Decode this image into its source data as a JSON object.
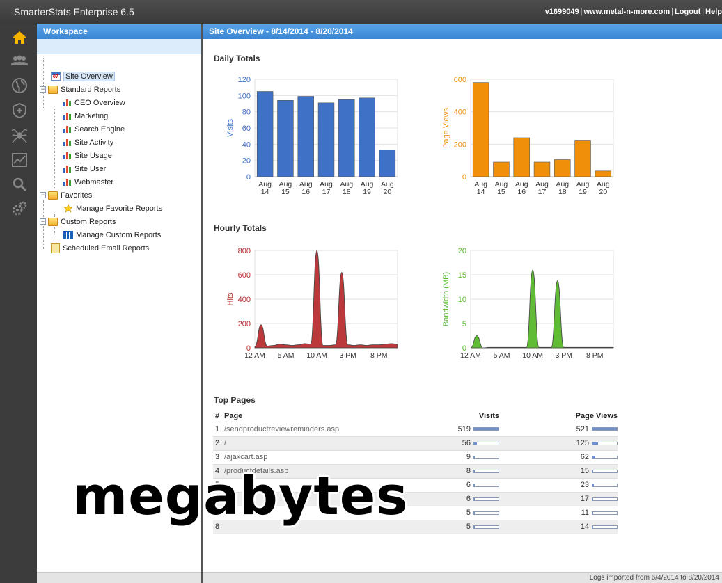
{
  "app": {
    "title": "SmarterStats Enterprise 6.5",
    "user_id": "v1699049",
    "site": "www.metal-n-more.com",
    "logout": "Logout",
    "help": "Help"
  },
  "iconbar": {
    "items": [
      "home-icon",
      "users-icon",
      "globe-icon",
      "shield-icon",
      "spider-icon",
      "chart-icon",
      "search-icon",
      "gears-icon"
    ]
  },
  "workspace": {
    "title": "Workspace",
    "tree": {
      "site_overview": "Site Overview",
      "site_overview_icon_text": "07",
      "standard_reports": "Standard Reports",
      "standard_items": [
        "CEO Overview",
        "Marketing",
        "Search Engine",
        "Site Activity",
        "Site Usage",
        "Site User",
        "Webmaster"
      ],
      "favorites": "Favorites",
      "manage_favorites": "Manage Favorite Reports",
      "custom_reports": "Custom Reports",
      "manage_custom": "Manage Custom Reports",
      "scheduled_email": "Scheduled Email Reports"
    }
  },
  "main": {
    "title": "Site Overview - 8/14/2014 - 8/20/2014",
    "daily_totals": "Daily Totals",
    "hourly_totals": "Hourly Totals",
    "top_pages": {
      "title": "Top Pages",
      "headers": {
        "num": "#",
        "page": "Page",
        "visits": "Visits",
        "page_views": "Page Views"
      },
      "max_visits": 519,
      "max_views": 521,
      "rows": [
        {
          "num": "1",
          "page": "/sendproductreviewreminders.asp",
          "visits": 519,
          "page_views": 521
        },
        {
          "num": "2",
          "page": "/",
          "visits": 56,
          "page_views": 125
        },
        {
          "num": "3",
          "page": "/ajaxcart.asp",
          "visits": 9,
          "page_views": 62
        },
        {
          "num": "4",
          "page": "/productdetails.asp",
          "visits": 8,
          "page_views": 15
        },
        {
          "num": "5",
          "page": "",
          "visits": 6,
          "page_views": 23
        },
        {
          "num": "6",
          "page": "",
          "visits": 6,
          "page_views": 17
        },
        {
          "num": "7",
          "page": "",
          "visits": 5,
          "page_views": 11
        },
        {
          "num": "8",
          "page": "",
          "visits": 5,
          "page_views": 14
        }
      ]
    },
    "footer": "Logs imported from 6/4/2014 to 8/20/2014"
  },
  "overlay_text": "megabytes",
  "colors": {
    "visits": "#3f72c7",
    "page_views": "#f0900a",
    "hits": "#b82e30",
    "bandwidth": "#58b82a",
    "header_blue": "#3a86d4"
  },
  "chart_data": [
    {
      "type": "bar",
      "id": "visits",
      "categories": [
        "Aug 14",
        "Aug 15",
        "Aug 16",
        "Aug 17",
        "Aug 18",
        "Aug 19",
        "Aug 20"
      ],
      "values": [
        105,
        94,
        99,
        91,
        95,
        97,
        33
      ],
      "ylabel": "Visits",
      "ylim": [
        0,
        120
      ],
      "yticks": [
        0,
        20,
        40,
        60,
        80,
        100,
        120
      ],
      "grid": true
    },
    {
      "type": "bar",
      "id": "page_views",
      "categories": [
        "Aug 14",
        "Aug 15",
        "Aug 16",
        "Aug 17",
        "Aug 18",
        "Aug 19",
        "Aug 20"
      ],
      "values": [
        580,
        90,
        240,
        90,
        105,
        225,
        35
      ],
      "ylabel": "Page Views",
      "ylim": [
        0,
        600
      ],
      "yticks": [
        0,
        200,
        400,
        600
      ],
      "grid": true
    },
    {
      "type": "area",
      "id": "hits",
      "x": [
        "12 AM",
        "1 AM",
        "2 AM",
        "3 AM",
        "4 AM",
        "5 AM",
        "6 AM",
        "7 AM",
        "8 AM",
        "9 AM",
        "10 AM",
        "11 AM",
        "12 PM",
        "1 PM",
        "2 PM",
        "3 PM",
        "4 PM",
        "5 PM",
        "6 PM",
        "7 PM",
        "8 PM",
        "9 PM",
        "10 PM",
        "11 PM"
      ],
      "values": [
        10,
        190,
        15,
        20,
        30,
        25,
        20,
        25,
        35,
        30,
        800,
        20,
        20,
        25,
        620,
        25,
        20,
        25,
        20,
        25,
        25,
        30,
        35,
        30
      ],
      "xticks": [
        "12 AM",
        "5 AM",
        "10 AM",
        "3 PM",
        "8 PM"
      ],
      "ylabel": "Hits",
      "ylim": [
        0,
        800
      ],
      "yticks": [
        0,
        200,
        400,
        600,
        800
      ],
      "grid": true
    },
    {
      "type": "area",
      "id": "bandwidth",
      "x": [
        "12 AM",
        "1 AM",
        "2 AM",
        "3 AM",
        "4 AM",
        "5 AM",
        "6 AM",
        "7 AM",
        "8 AM",
        "9 AM",
        "10 AM",
        "11 AM",
        "12 PM",
        "1 PM",
        "2 PM",
        "3 PM",
        "4 PM",
        "5 PM",
        "6 PM",
        "7 PM",
        "8 PM",
        "9 PM",
        "10 PM",
        "11 PM"
      ],
      "values": [
        0,
        2.5,
        0,
        0.1,
        0.1,
        0.1,
        0.1,
        0.1,
        0.1,
        0.1,
        16,
        0.1,
        0.1,
        0.1,
        13.8,
        0.1,
        0.1,
        0.1,
        0.1,
        0.1,
        0.1,
        0.1,
        0.1,
        0.1
      ],
      "xticks": [
        "12 AM",
        "5 AM",
        "10 AM",
        "3 PM",
        "8 PM"
      ],
      "ylabel": "Bandwidth (MB)",
      "ylim": [
        0,
        20
      ],
      "yticks": [
        0,
        5,
        10,
        15,
        20
      ],
      "grid": true
    }
  ]
}
